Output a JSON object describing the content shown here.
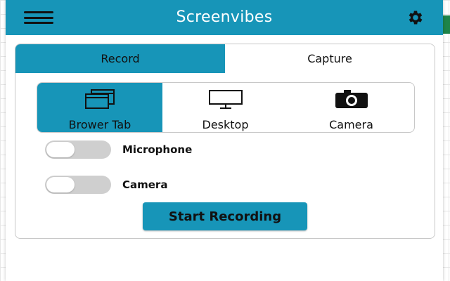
{
  "app": {
    "title": "Screenvibes"
  },
  "header": {
    "menu_icon": "hamburger-menu-icon",
    "settings_icon": "gear-icon"
  },
  "tabs": [
    {
      "label": "Record",
      "active": true
    },
    {
      "label": "Capture",
      "active": false
    }
  ],
  "sources": [
    {
      "label": "Brower Tab",
      "icon": "browser-tabs-icon",
      "active": true
    },
    {
      "label": "Desktop",
      "icon": "monitor-icon",
      "active": false
    },
    {
      "label": "Camera",
      "icon": "camera-icon",
      "active": false
    }
  ],
  "toggles": [
    {
      "label": "Microphone",
      "on": false
    },
    {
      "label": "Camera",
      "on": false
    }
  ],
  "actions": {
    "start_label": "Start Recording"
  },
  "colors": {
    "accent": "#1795b8",
    "toggle_off": "#cfcfcf",
    "text": "#111111"
  }
}
